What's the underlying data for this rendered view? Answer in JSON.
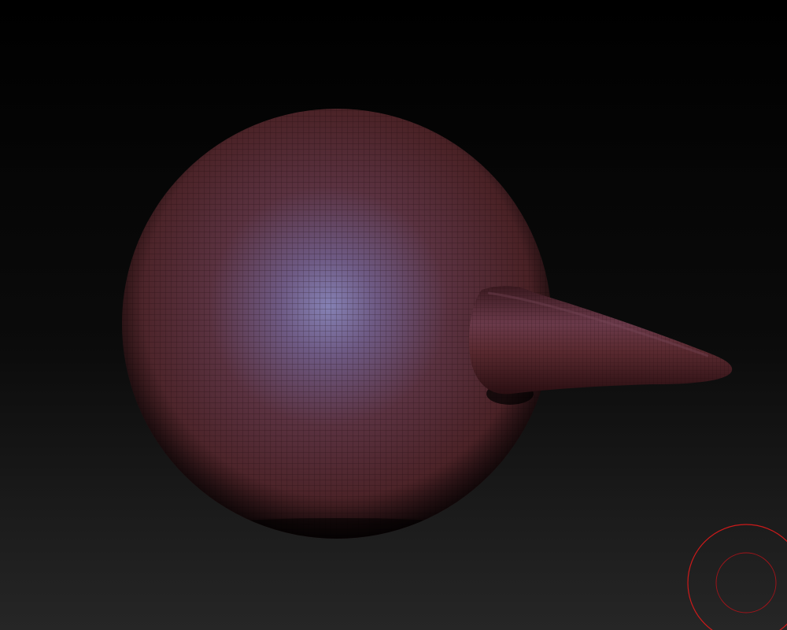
{
  "scene": {
    "background_top": "#000000",
    "background_bottom": "#262626",
    "mesh_color": "#6a2c30",
    "highlight_color": "#8c88c0",
    "brush_color": "#cc1a1a"
  },
  "icons": {
    "brush_cursor": "brush-cursor-icon"
  }
}
